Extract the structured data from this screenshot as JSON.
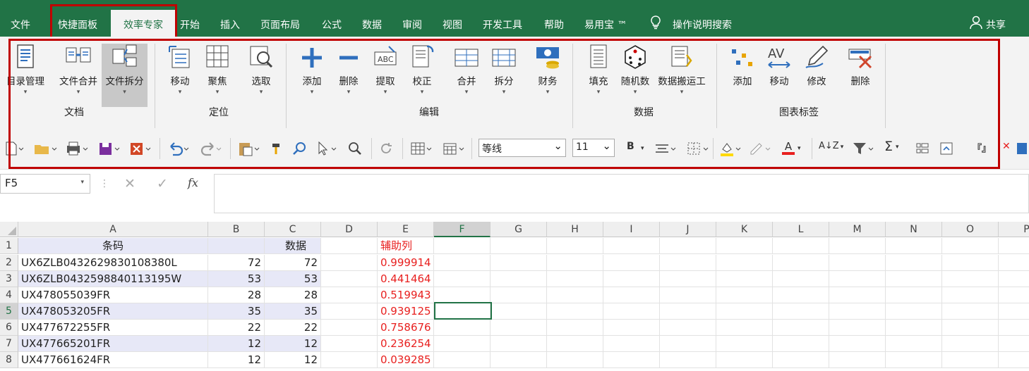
{
  "menu": {
    "file": "文件",
    "tab_kuaijie": "快捷面板",
    "tab_xiaolv": "效率专家",
    "tab_start": "开始",
    "tab_insert": "插入",
    "tab_layout": "页面布局",
    "tab_formula": "公式",
    "tab_data": "数据",
    "tab_review": "审阅",
    "tab_view": "视图",
    "tab_dev": "开发工具",
    "tab_help": "帮助",
    "tab_yiyong": "易用宝 ™",
    "tell_me": "操作说明搜索",
    "share": "共享"
  },
  "ribbon": {
    "doc": {
      "label": "文档",
      "b1": "目录管理",
      "b2": "文件合并",
      "b3": "文件拆分"
    },
    "locate": {
      "label": "定位",
      "b1": "移动",
      "b2": "聚焦",
      "b3": "选取"
    },
    "edit": {
      "label": "编辑",
      "b1": "添加",
      "b2": "删除",
      "b3": "提取",
      "b4": "校正",
      "b5": "合并",
      "b6": "拆分",
      "b7": "财务"
    },
    "data": {
      "label": "数据",
      "b1": "填充",
      "b2": "随机数",
      "b3": "数据搬运工"
    },
    "chart": {
      "label": "图表标签",
      "b1": "添加",
      "b2": "移动",
      "b3": "修改",
      "b4": "删除"
    }
  },
  "qat": {
    "font": "等线",
    "size": "11",
    "bold": "B",
    "fontcolor": "A",
    "sigma": "Σ",
    "az": "A↓Z"
  },
  "formula": {
    "namebox": "F5",
    "fx": "fx",
    "cancel": "✕",
    "enter": "✓",
    "value": ""
  },
  "sheet": {
    "columns": [
      "A",
      "B",
      "C",
      "D",
      "E",
      "F",
      "G",
      "H",
      "I",
      "J",
      "K",
      "L",
      "M",
      "N",
      "O",
      "P"
    ],
    "rows": [
      {
        "n": "1",
        "a": "条码",
        "b": "",
        "c": "数据",
        "e": "辅助列"
      },
      {
        "n": "2",
        "a": "UX6ZLB0432629830108380L",
        "b": "72",
        "c": "72",
        "e": "0.999914"
      },
      {
        "n": "3",
        "a": "UX6ZLB0432598840113195W",
        "b": "53",
        "c": "53",
        "e": "0.441464"
      },
      {
        "n": "4",
        "a": "UX478055039FR",
        "b": "28",
        "c": "28",
        "e": "0.519943"
      },
      {
        "n": "5",
        "a": "UX478053205FR",
        "b": "35",
        "c": "35",
        "e": "0.939125"
      },
      {
        "n": "6",
        "a": "UX477672255FR",
        "b": "22",
        "c": "22",
        "e": "0.758676"
      },
      {
        "n": "7",
        "a": "UX477665201FR",
        "b": "12",
        "c": "12",
        "e": "0.236254"
      },
      {
        "n": "8",
        "a": "UX477661624FR",
        "b": "12",
        "c": "12",
        "e": "0.039285"
      }
    ],
    "selected_col": "F",
    "selected_row": "5"
  },
  "colors": {
    "excel_green": "#217346",
    "highlight_red": "#c00000",
    "band": "#e7e8f7",
    "helper_text": "#e8201f"
  }
}
